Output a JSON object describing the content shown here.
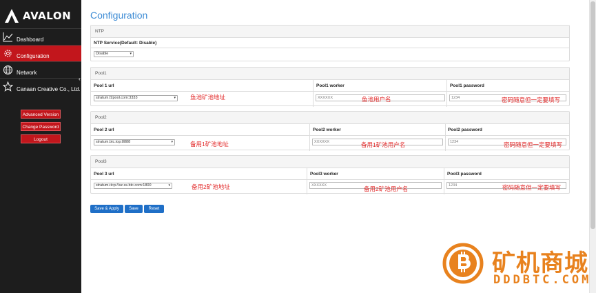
{
  "brand": {
    "name": "AVALON"
  },
  "nav": [
    {
      "label": "Dashboard",
      "icon": "chart-line-icon"
    },
    {
      "label": "Configuration",
      "icon": "gear-icon",
      "active": true
    },
    {
      "label": "Network",
      "icon": "globe-icon"
    },
    {
      "label": "Canaan Creative Co., Ltd.",
      "icon": "star-icon"
    }
  ],
  "side_buttons": {
    "advanced": "Advanced Version",
    "change_password": "Change Password",
    "logout": "Logout"
  },
  "page": {
    "title": "Configuration"
  },
  "ntp": {
    "title": "NTP",
    "label": "NTP Service(Default: Disable)",
    "value": "Disable"
  },
  "pools": [
    {
      "title": "Pool1",
      "url_header": "Pool 1 url",
      "worker_header": "Pool1 worker",
      "password_header": "Pool1 password",
      "url": "stratum.f2pool.com:3333",
      "worker": "XXXXXX",
      "password": "1234",
      "note_url": "鱼池矿池地址",
      "note_worker": "鱼池用户名",
      "note_password": "密码随意但一定要填写"
    },
    {
      "title": "Pool2",
      "url_header": "Pool 2 url",
      "worker_header": "Pool2 worker",
      "password_header": "Pool2 password",
      "url": "stratum.btc.top:8888",
      "worker": "XXXXXX",
      "password": "1234",
      "note_url": "备用1矿池地址",
      "note_worker": "备用1矿池用户名",
      "note_password": "密码随意但一定要填写"
    },
    {
      "title": "Pool3",
      "url_header": "Pool 3 url",
      "worker_header": "Pool3 worker",
      "password_header": "Pool3 password",
      "url": "stratum+tcp://sz.ss.btc.com:1800",
      "worker": "XXXXXX",
      "password": "1234",
      "note_url": "备用2矿池地址",
      "note_worker": "备用2矿池用户名",
      "note_password": "密码随意但一定要填写"
    }
  ],
  "actions": {
    "save_apply": "Save & Apply",
    "save": "Save",
    "reset": "Reset"
  },
  "watermark": {
    "cn": "矿机商城",
    "en": "DDDBTC.COM"
  },
  "colors": {
    "accent_red": "#c2161c",
    "title_blue": "#3b8ad4",
    "button_blue": "#1f6fc7",
    "note_red": "#e22a2a",
    "watermark_orange": "#e8821e"
  }
}
